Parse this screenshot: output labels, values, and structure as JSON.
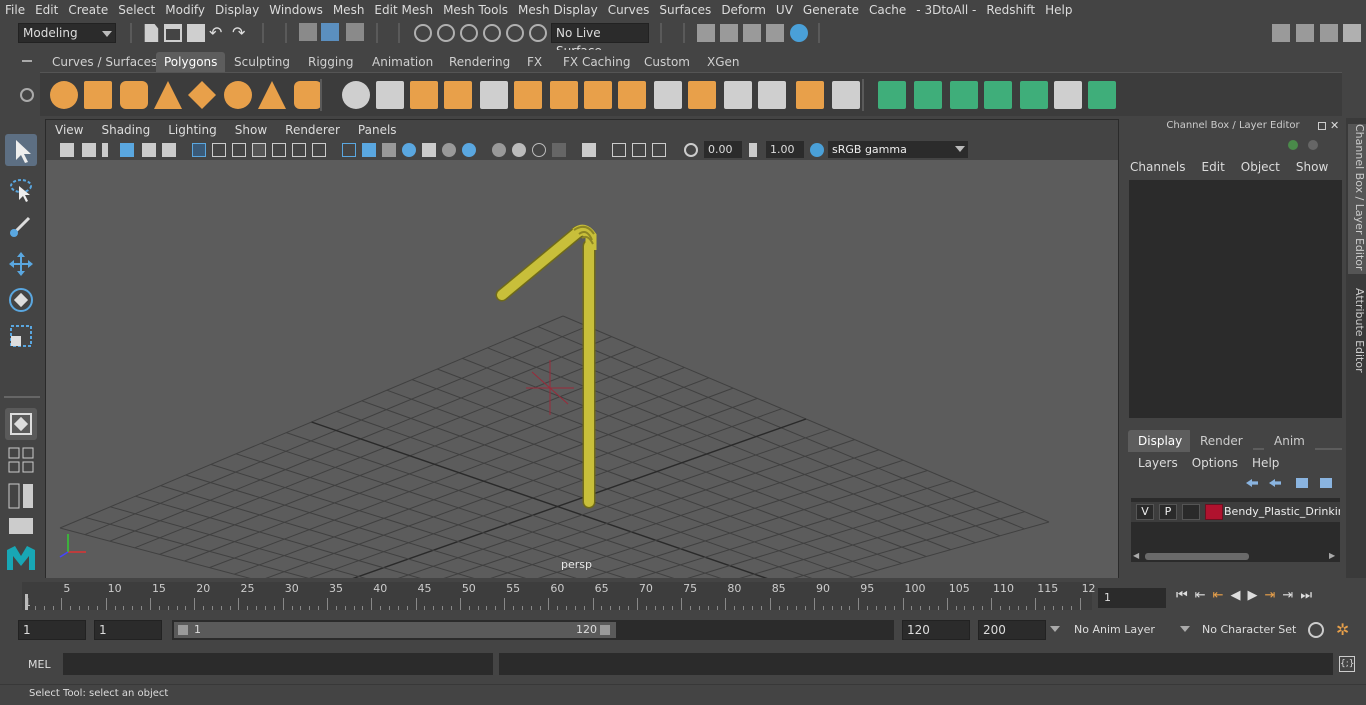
{
  "menubar": {
    "items": [
      "File",
      "Edit",
      "Create",
      "Select",
      "Modify",
      "Display",
      "Windows",
      "Mesh",
      "Edit Mesh",
      "Mesh Tools",
      "Mesh Display",
      "Curves",
      "Surfaces",
      "Deform",
      "UV",
      "Generate",
      "Cache",
      "- 3DtoAll -",
      "Redshift",
      "Help"
    ]
  },
  "statusline": {
    "mode_value": "Modeling",
    "live_surface": "No Live Surface"
  },
  "shelf": {
    "tabs": [
      "Curves / Surfaces",
      "Polygons",
      "Sculpting",
      "Rigging",
      "Animation",
      "Rendering",
      "FX",
      "FX Caching",
      "Custom",
      "XGen"
    ],
    "active_tab": "Polygons"
  },
  "viewport": {
    "menu": [
      "View",
      "Shading",
      "Lighting",
      "Show",
      "Renderer",
      "Panels"
    ],
    "exposure": "0.00",
    "gamma": "1.00",
    "colorspace": "sRGB gamma",
    "camera_label": "persp"
  },
  "channelbox": {
    "title": "Channel Box / Layer Editor",
    "menu": [
      "Channels",
      "Edit",
      "Object",
      "Show"
    ]
  },
  "layers": {
    "tabs": [
      "Display",
      "Render",
      "Anim"
    ],
    "active_tab": "Display",
    "menu": [
      "Layers",
      "Options",
      "Help"
    ],
    "layer": {
      "v": "V",
      "p": "P",
      "name": "Bendy_Plastic_Drinking",
      "color": "#b0122e"
    }
  },
  "side_tabs": [
    "Channel Box / Layer Editor",
    "Attribute Editor"
  ],
  "timeline": {
    "labels": [
      "5",
      "10",
      "15",
      "20",
      "25",
      "30",
      "35",
      "40",
      "45",
      "50",
      "55",
      "60",
      "65",
      "70",
      "75",
      "80",
      "85",
      "90",
      "95",
      "100",
      "105",
      "110",
      "115",
      "12"
    ],
    "start_label": "1",
    "current_frame": "1"
  },
  "range": {
    "start": "1",
    "playback_start": "1",
    "slider_start": "1",
    "slider_end": "120",
    "playback_end": "120",
    "end": "200",
    "anim_layer": "No Anim Layer",
    "character_set": "No Character Set"
  },
  "mel": {
    "label": "MEL"
  },
  "help": {
    "text": "Select Tool: select an object"
  },
  "colors": {
    "shelf_orange": "#e8a04a",
    "shelf_green": "#3fae7a",
    "straw": "#c8bf3a"
  }
}
